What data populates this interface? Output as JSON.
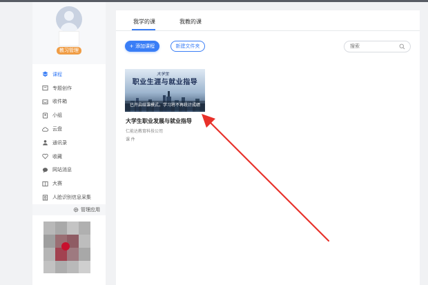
{
  "sidebar": {
    "role_badge": "教习管理",
    "items": [
      {
        "label": "课程",
        "icon": "course-icon",
        "active": true
      },
      {
        "label": "专题创作",
        "icon": "topic-icon"
      },
      {
        "label": "收件箱",
        "icon": "inbox-icon"
      },
      {
        "label": "小组",
        "icon": "group-icon"
      },
      {
        "label": "云盘",
        "icon": "cloud-icon"
      },
      {
        "label": "通讯录",
        "icon": "contacts-icon"
      },
      {
        "label": "收藏",
        "icon": "favorite-icon"
      },
      {
        "label": "网站消息",
        "icon": "message-icon"
      },
      {
        "label": "大赛",
        "icon": "contest-icon"
      },
      {
        "label": "人脸识别信息采集",
        "icon": "face-id-icon"
      }
    ],
    "manage_label": "管理应用"
  },
  "tabs": [
    {
      "label": "我学的课",
      "active": true
    },
    {
      "label": "我教的课"
    }
  ],
  "toolbar": {
    "add_course_label": "添加课程",
    "new_folder_label": "新建文件夹",
    "search_placeholder": "搜索"
  },
  "course": {
    "cover_script": "大学生",
    "cover_title": "职业生涯与就业指导",
    "cover_status": "已开启结课模式，学习将不再统计成绩",
    "title": "大学生职业发展与就业指导",
    "org": "仁能达教育科技公司",
    "type": "课 件"
  },
  "colors": {
    "accent": "#3a7ef6",
    "badge": "#f09d45",
    "arrow": "#e8312a"
  }
}
